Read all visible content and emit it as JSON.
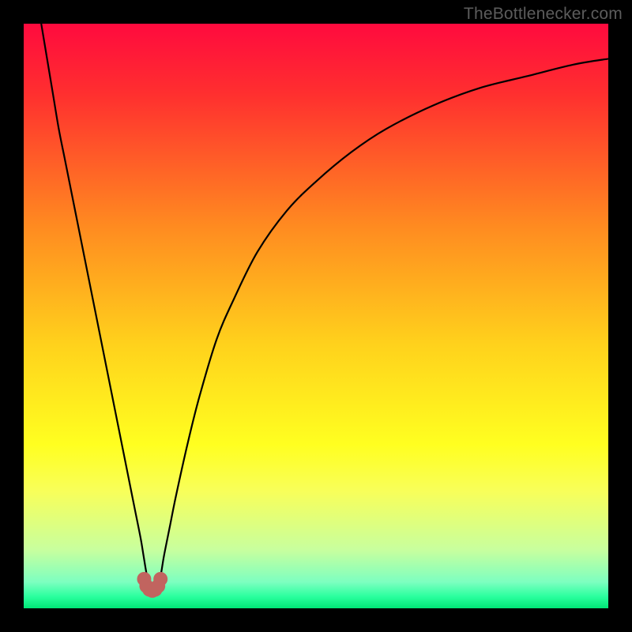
{
  "attribution": "TheBottlenecker.com",
  "chart_data": {
    "type": "line",
    "title": "",
    "xlabel": "",
    "ylabel": "",
    "xlim": [
      0,
      100
    ],
    "ylim": [
      0,
      100
    ],
    "gradient_stops": [
      {
        "offset": 0,
        "color": "#ff0a3e"
      },
      {
        "offset": 0.12,
        "color": "#ff2f2f"
      },
      {
        "offset": 0.35,
        "color": "#ff8c20"
      },
      {
        "offset": 0.55,
        "color": "#ffd21c"
      },
      {
        "offset": 0.72,
        "color": "#ffff20"
      },
      {
        "offset": 0.8,
        "color": "#f8ff5a"
      },
      {
        "offset": 0.9,
        "color": "#c8ff9e"
      },
      {
        "offset": 0.955,
        "color": "#7dffc0"
      },
      {
        "offset": 0.98,
        "color": "#2aff9e"
      },
      {
        "offset": 1.0,
        "color": "#00e676"
      }
    ],
    "series": [
      {
        "name": "bottleneck-curve",
        "x": [
          3,
          4,
          5,
          6,
          7,
          8,
          9,
          10,
          11,
          12,
          13,
          14,
          15,
          16,
          17,
          18,
          19,
          20,
          20.5,
          21,
          21.5,
          22,
          22.5,
          23,
          23.5,
          24,
          25,
          26,
          28,
          30,
          33,
          36,
          40,
          45,
          50,
          56,
          62,
          70,
          78,
          86,
          94,
          100
        ],
        "y": [
          100,
          94,
          88,
          82,
          77,
          72,
          67,
          62,
          57,
          52,
          47,
          42,
          37,
          32,
          27,
          22,
          17,
          12,
          9,
          6,
          4,
          3,
          3,
          4,
          6,
          9,
          14,
          19,
          28,
          36,
          46,
          53,
          61,
          68,
          73,
          78,
          82,
          86,
          89,
          91,
          93,
          94
        ]
      }
    ],
    "marker_cluster": {
      "color": "#c1645f",
      "points": [
        {
          "x": 20.6,
          "y": 5.0
        },
        {
          "x": 21.0,
          "y": 3.8
        },
        {
          "x": 21.5,
          "y": 3.2
        },
        {
          "x": 22.0,
          "y": 3.0
        },
        {
          "x": 22.5,
          "y": 3.2
        },
        {
          "x": 23.0,
          "y": 3.8
        },
        {
          "x": 23.4,
          "y": 5.0
        }
      ],
      "radius_px": 9
    }
  }
}
